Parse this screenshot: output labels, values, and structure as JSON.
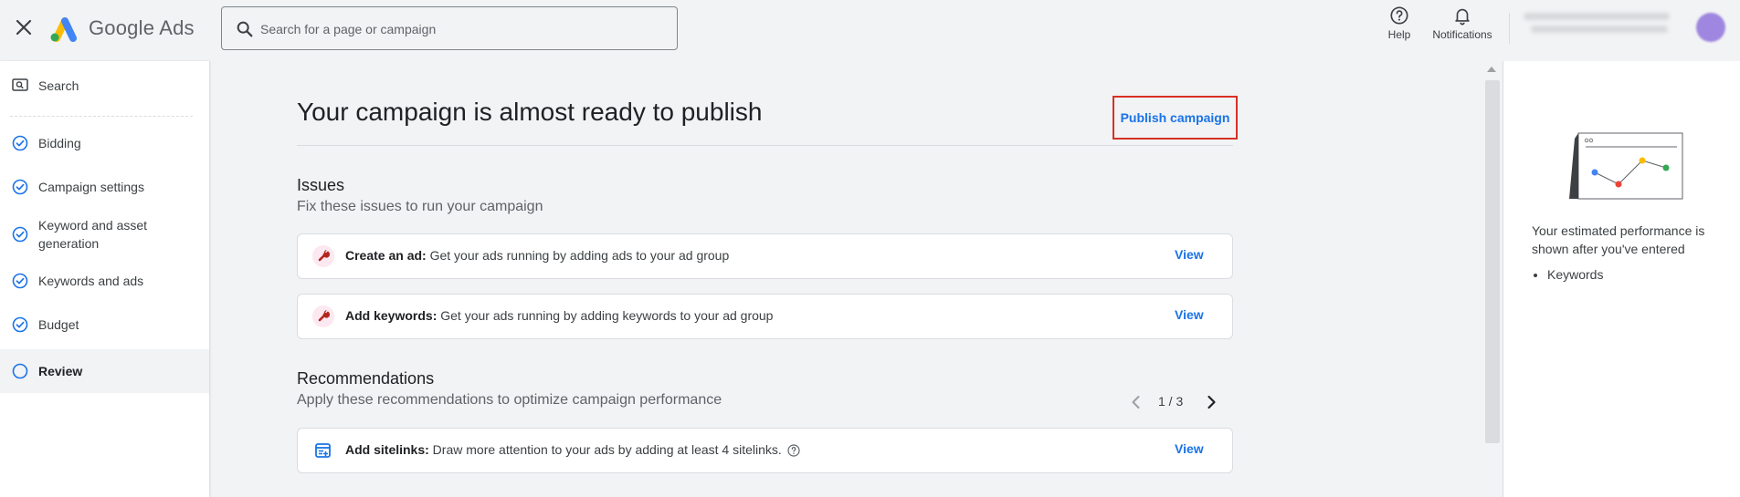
{
  "app": {
    "brand": "Google Ads",
    "search_placeholder": "Search for a page or campaign"
  },
  "header_actions": {
    "help_label": "Help",
    "notifications_label": "Notifications"
  },
  "sidebar": {
    "items": [
      {
        "label": "Search",
        "icon": "search-icon",
        "state": "default"
      },
      {
        "label": "Bidding",
        "icon": "check-circle-icon",
        "state": "done"
      },
      {
        "label": "Campaign settings",
        "icon": "check-circle-icon",
        "state": "done"
      },
      {
        "label": "Keyword and asset generation",
        "icon": "check-circle-icon",
        "state": "done"
      },
      {
        "label": "Keywords and ads",
        "icon": "check-circle-icon",
        "state": "done"
      },
      {
        "label": "Budget",
        "icon": "check-circle-icon",
        "state": "done"
      },
      {
        "label": "Review",
        "icon": "circle-icon",
        "state": "active"
      }
    ]
  },
  "main": {
    "title": "Your campaign is almost ready to publish",
    "publish_label": "Publish campaign",
    "issues": {
      "heading": "Issues",
      "subheading": "Fix these issues to run your campaign",
      "items": [
        {
          "bold": "Create an ad:",
          "text": " Get your ads running by adding ads to your ad group",
          "action": "View"
        },
        {
          "bold": "Add keywords:",
          "text": " Get your ads running by adding keywords to your ad group",
          "action": "View"
        }
      ]
    },
    "recommendations": {
      "heading": "Recommendations",
      "subheading": "Apply these recommendations to optimize campaign performance",
      "pager": "1 / 3",
      "items": [
        {
          "bold": "Add sitelinks:",
          "text": " Draw more attention to your ads by adding at least 4 sitelinks.",
          "action": "View"
        }
      ]
    }
  },
  "right_panel": {
    "text": "Your estimated performance is shown after you've entered",
    "list": [
      "Keywords"
    ]
  },
  "colors": {
    "accent": "#1a73e8",
    "highlight_border": "#d93025",
    "background": "#f1f3f4"
  }
}
